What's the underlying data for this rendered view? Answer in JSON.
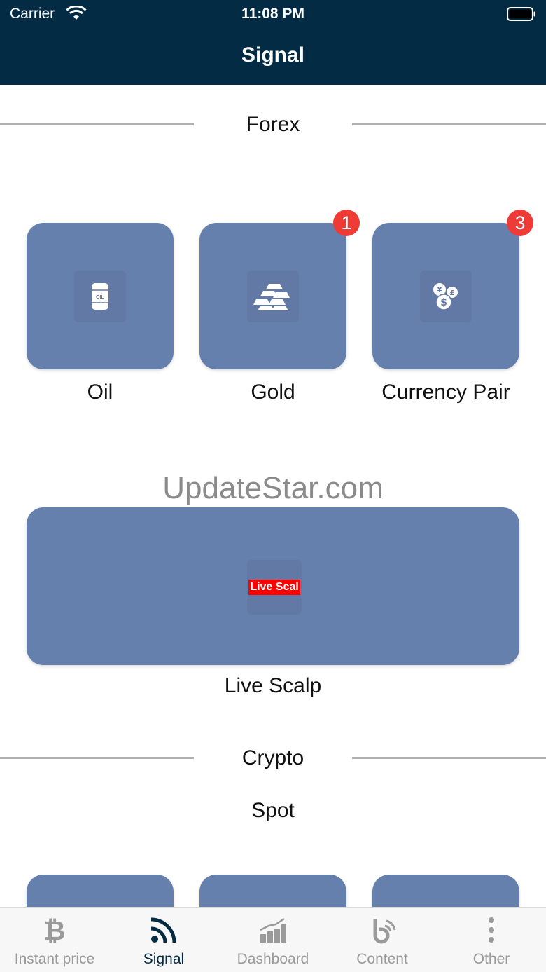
{
  "status_bar": {
    "carrier": "Carrier",
    "time": "11:08 PM"
  },
  "nav": {
    "title": "Signal"
  },
  "forex": {
    "header": "Forex",
    "tiles": [
      {
        "label": "Oil",
        "icon": "oil-barrel-icon",
        "icon_text": "OIL"
      },
      {
        "label": "Gold",
        "icon": "gold-bars-icon",
        "badge": "1"
      },
      {
        "label": "Currency Pair",
        "icon": "currency-coins-icon",
        "badge": "3"
      }
    ],
    "live_scalp": {
      "label": "Live Scalp",
      "tag": "Live Scal"
    }
  },
  "watermark": "UpdateStar.com",
  "crypto": {
    "header": "Crypto",
    "sub_header": "Spot"
  },
  "tab_bar": {
    "items": [
      {
        "label": "Instant price",
        "icon": "bitcoin-icon",
        "active": false
      },
      {
        "label": "Signal",
        "icon": "rss-signal-icon",
        "active": true
      },
      {
        "label": "Dashboard",
        "icon": "bar-chart-icon",
        "active": false
      },
      {
        "label": "Content",
        "icon": "content-icon",
        "active": false
      },
      {
        "label": "Other",
        "icon": "more-vertical-icon",
        "active": false
      }
    ]
  },
  "colors": {
    "nav_background": "#042b44",
    "tile_background": "#6680ad",
    "badge": "#ef3a36",
    "tab_active": "#042b44",
    "tab_inactive": "#9a9a9a"
  }
}
